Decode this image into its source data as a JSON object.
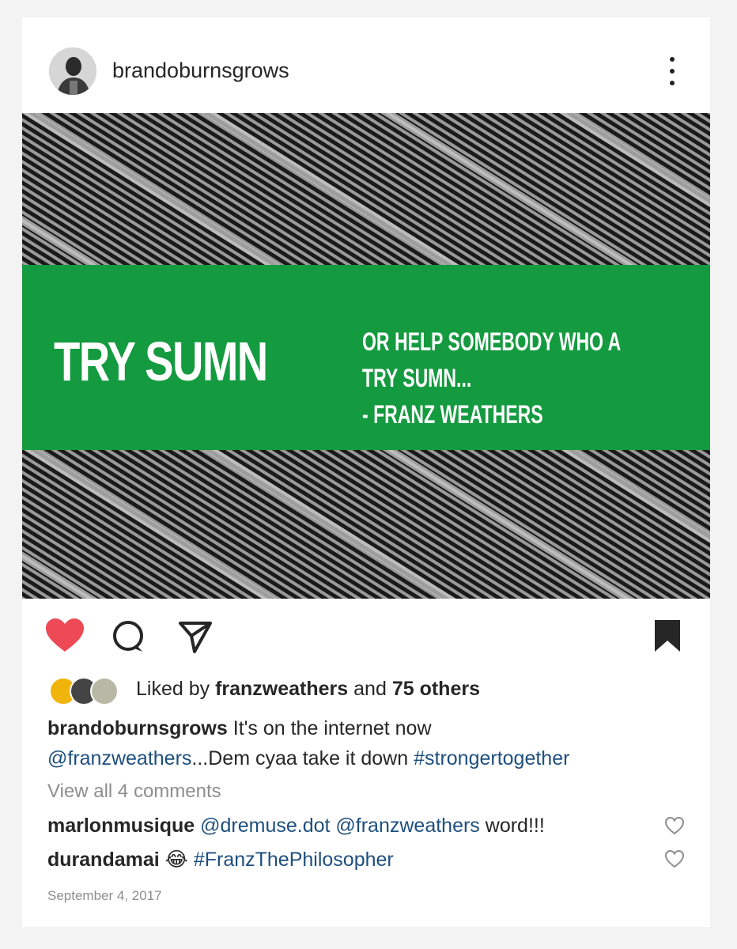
{
  "post": {
    "username": "brandoburnsgrows",
    "image": {
      "headline": "TRY SUMN",
      "quote_lines": [
        "OR HELP SOMEBODY WHO A",
        "TRY SUMN...",
        "- FRANZ WEATHERS"
      ],
      "banner_color": "#149a3f"
    },
    "likes": {
      "prefix": "Liked by",
      "user": "franzweathers",
      "and": "and",
      "others": "75 others"
    },
    "caption": {
      "username": "brandoburnsgrows",
      "text_1": "It's on the internet now",
      "mention": "@franzweathers",
      "text_2": "...Dem cyaa take it down",
      "hashtag": "#strongertogether"
    },
    "view_all_comments": "View all 4 comments",
    "comments": [
      {
        "username": "marlonmusique",
        "mention_1": "@dremuse.dot",
        "mention_2": "@franzweathers",
        "text": "word!!!"
      },
      {
        "username": "durandamai",
        "emoji": "😂",
        "hashtag": "#FranzThePhilosopher"
      }
    ],
    "date": "September 4, 2017"
  },
  "icons": {
    "more": "more-options-icon",
    "like": "heart-icon",
    "comment": "comment-icon",
    "share": "share-icon",
    "save": "bookmark-icon"
  },
  "colors": {
    "like_red": "#ed4956",
    "link_blue": "#1e4f7e",
    "muted": "#8e8e8e"
  }
}
